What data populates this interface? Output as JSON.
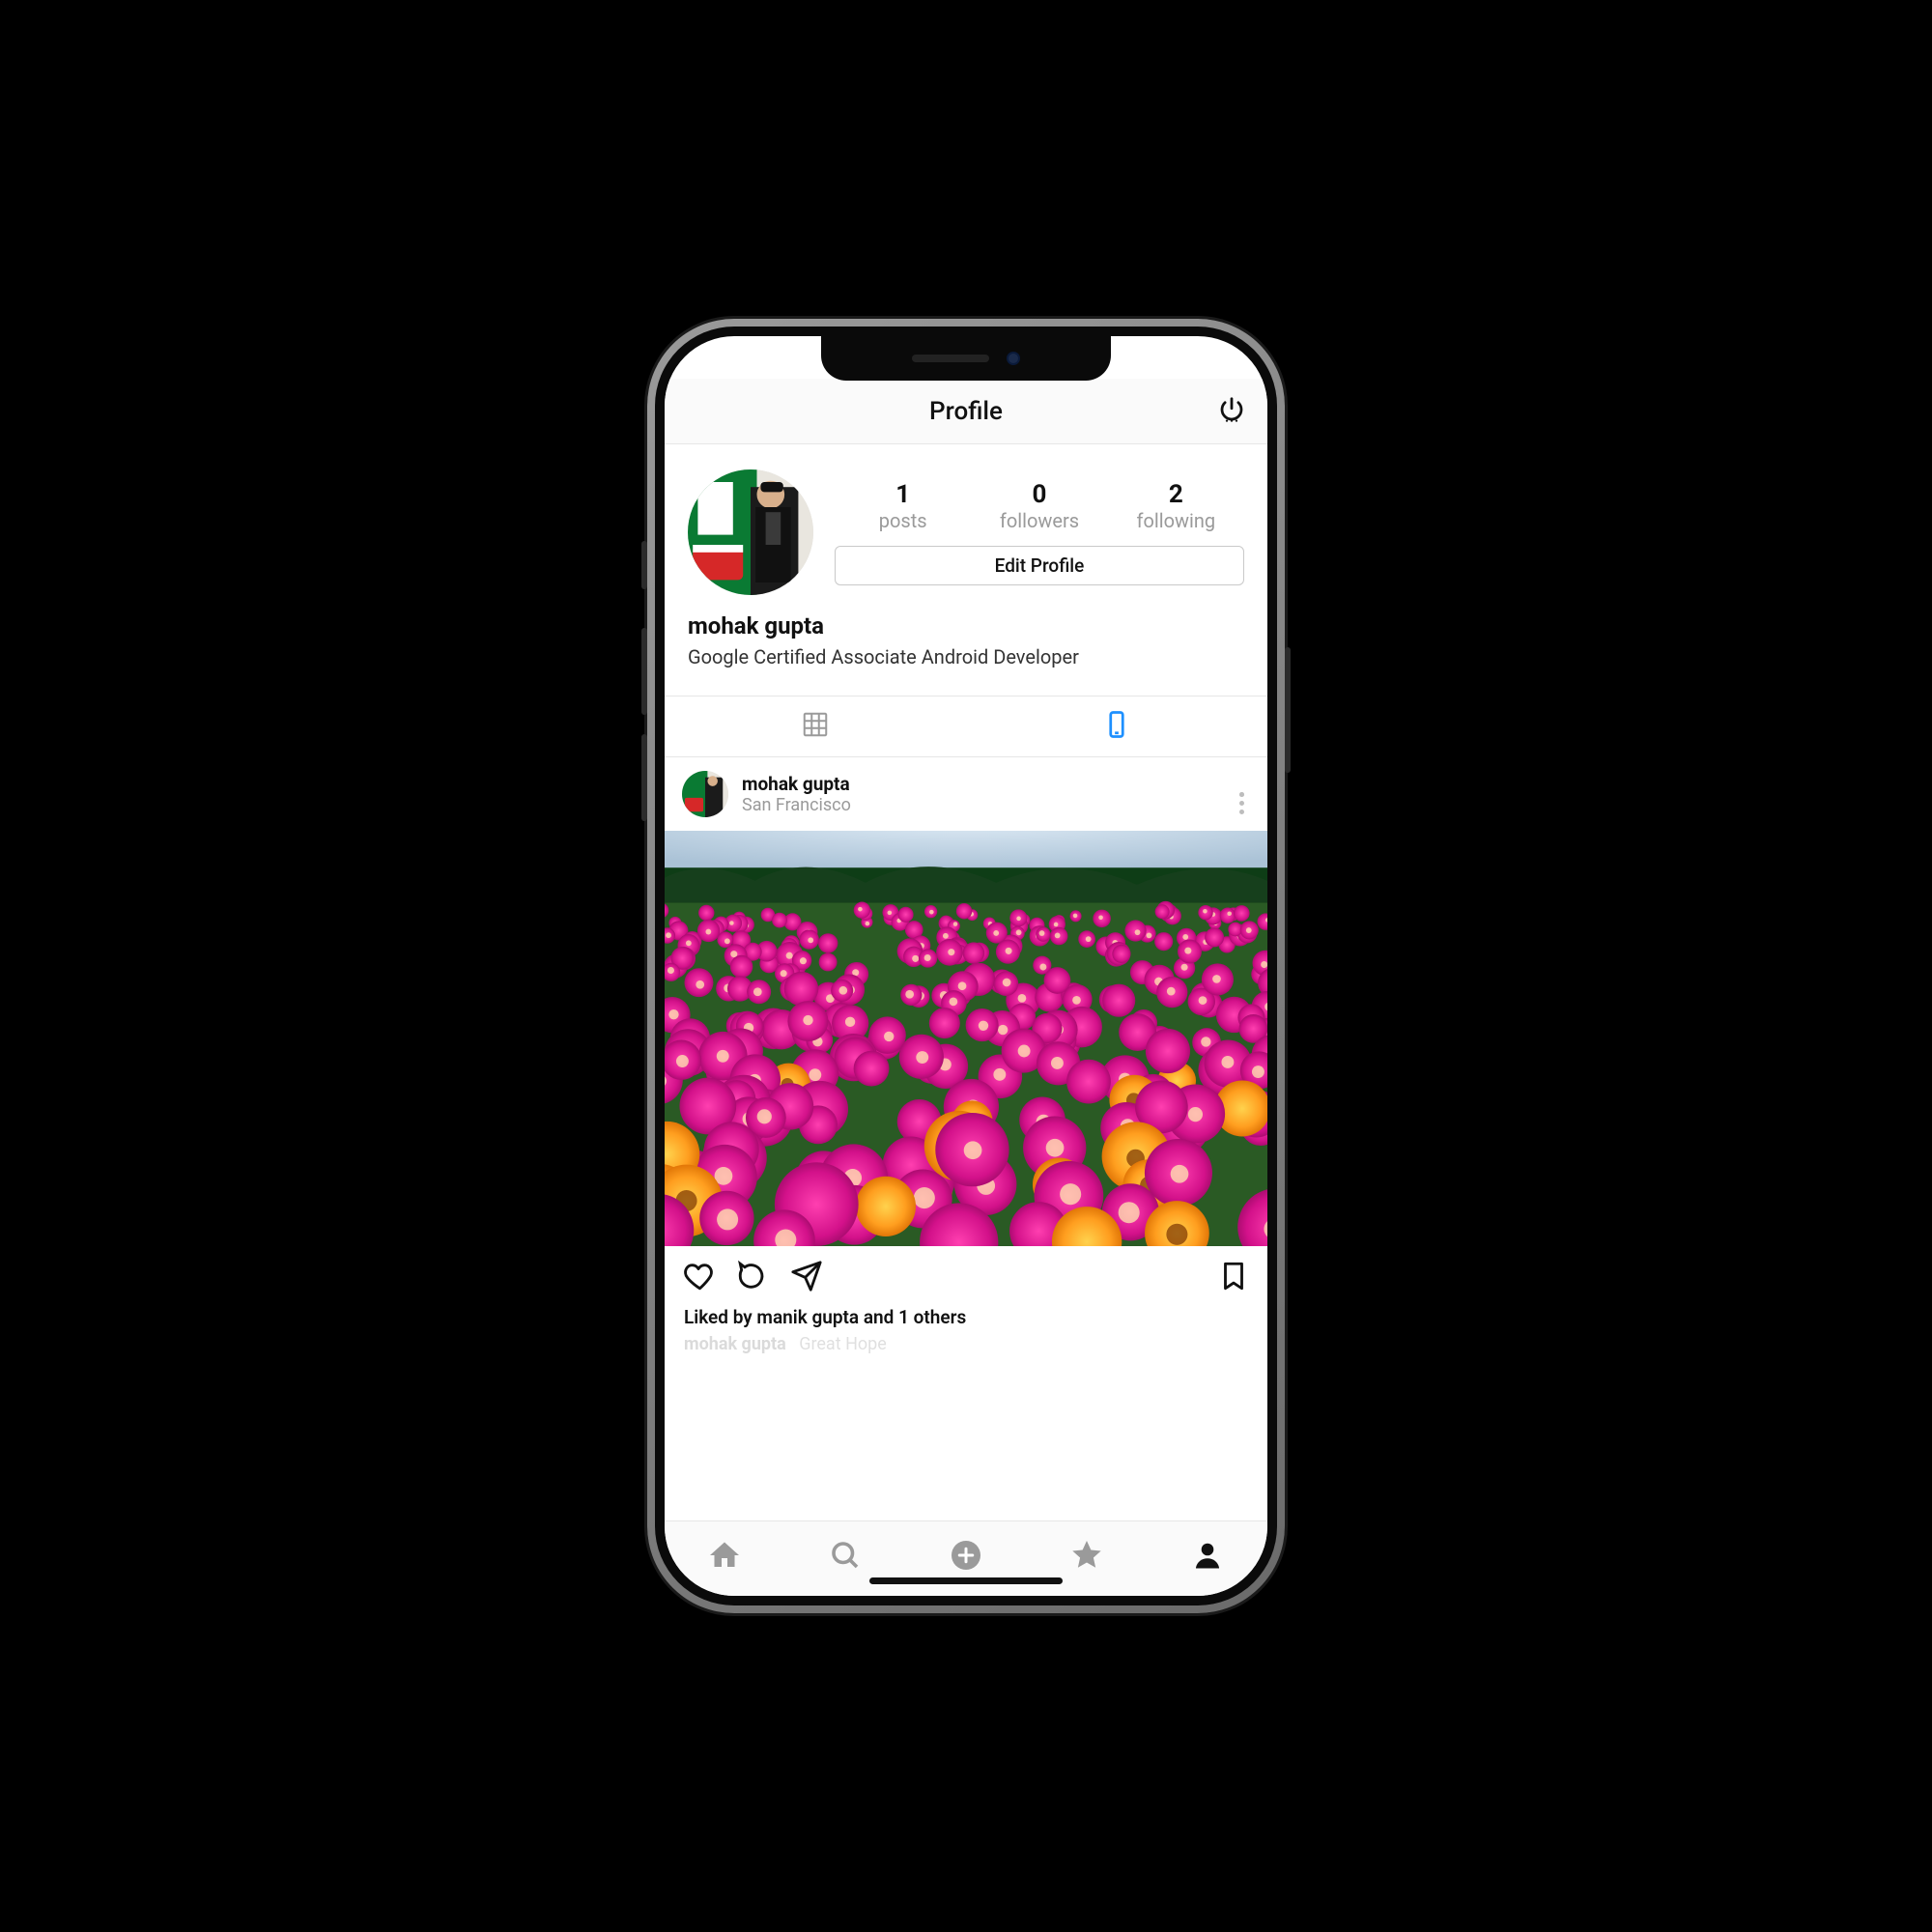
{
  "header": {
    "title": "Profile"
  },
  "profile": {
    "name": "mohak gupta",
    "bio": "Google Certified Associate Android Developer",
    "stats": {
      "posts": {
        "count": "1",
        "label": "posts"
      },
      "followers": {
        "count": "0",
        "label": "followers"
      },
      "following": {
        "count": "2",
        "label": "following"
      }
    },
    "edit_label": "Edit Profile"
  },
  "post": {
    "username": "mohak gupta",
    "location": "San Francisco",
    "likes_text": "Liked by manik gupta and 1 others",
    "caption_user": "mohak gupta",
    "caption_text": "Great Hope"
  },
  "colors": {
    "accent": "#1e90ff",
    "muted": "#9a9a9a",
    "border": "#e6e6e6"
  }
}
